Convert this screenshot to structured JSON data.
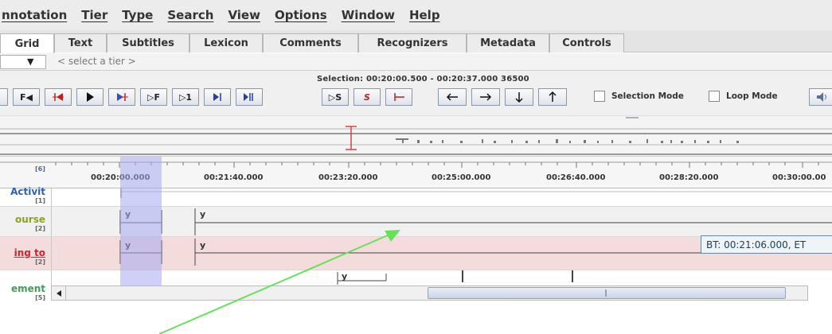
{
  "menu": [
    "nnotation",
    "Tier",
    "Type",
    "Search",
    "View",
    "Options",
    "Window",
    "Help"
  ],
  "tabs": [
    "Grid",
    "Text",
    "Subtitles",
    "Lexicon",
    "Comments",
    "Recognizers",
    "Metadata",
    "Controls"
  ],
  "active_tab": "Grid",
  "tier_selector": {
    "arrow": "▼",
    "text": "< select a tier >"
  },
  "selection_readout": "Selection: 00:20:00.500 - 00:20:37.000  36500",
  "player_buttons": {
    "b1": "F◀",
    "b5": "▷F",
    "b6": "▷1",
    "sel_s": "▷S",
    "sel_loop": "S"
  },
  "selection_mode_label": "Selection Mode",
  "loop_mode_label": "Loop Mode",
  "ruler": {
    "first_label": "[6]",
    "ticks": [
      "00:20:00.000",
      "00:21:40.000",
      "00:23:20.000",
      "00:25:00.000",
      "00:26:40.000",
      "00:28:20.000",
      "00:30:00.00"
    ]
  },
  "tiers": [
    {
      "name": "Activit",
      "count": "[1]",
      "color": "#2f5fb0"
    },
    {
      "name": "ourse",
      "count": "[2]",
      "color": "#8aa320"
    },
    {
      "name": "ing to",
      "count": "[2]",
      "color": "#d2232a"
    },
    {
      "name": "ement",
      "count": "[5]",
      "color": "#3f9e5a"
    }
  ],
  "annotations": {
    "a1": "y",
    "a2": "y",
    "b1": "y",
    "b2": "y",
    "c1": "y"
  },
  "tooltip": "BT: 00:21:06.000, ET",
  "colors": {
    "selection": "#a5aaf0",
    "arrow": "#66e25a",
    "playhead": "#d94343"
  }
}
